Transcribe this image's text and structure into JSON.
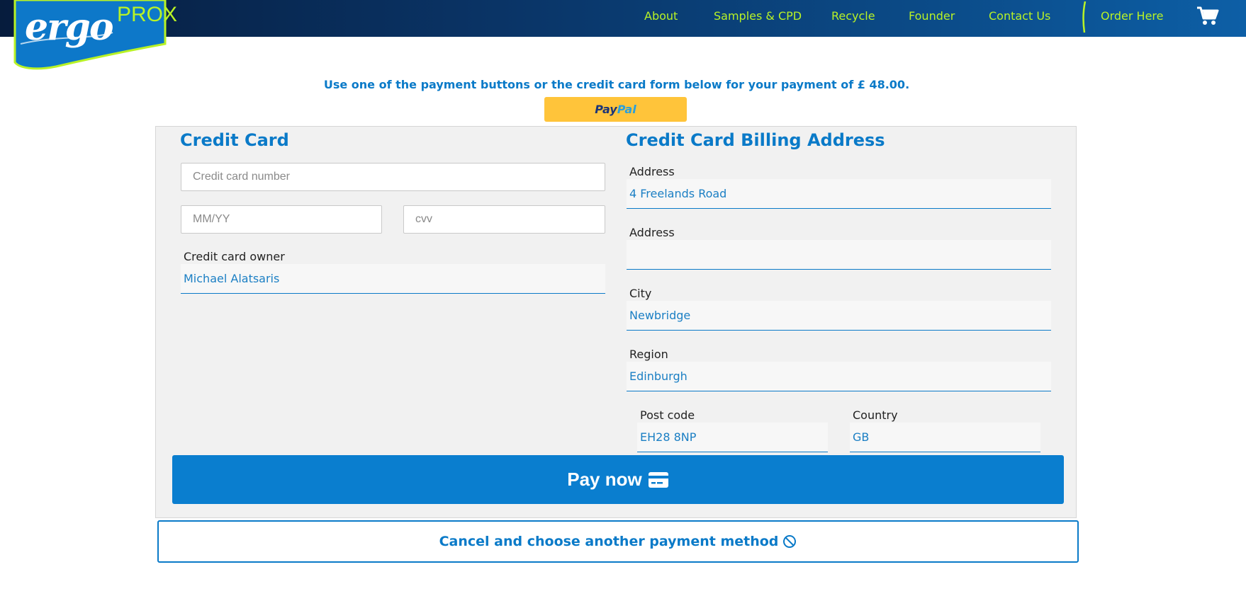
{
  "brand": {
    "logo_main": "ergo",
    "logo_sub": "PROX"
  },
  "nav": {
    "items": [
      {
        "label": "About"
      },
      {
        "label": "Samples & CPD"
      },
      {
        "label": "Recycle"
      },
      {
        "label": "Founder"
      },
      {
        "label": "Contact Us"
      },
      {
        "label": "Order Here"
      }
    ]
  },
  "payment": {
    "intro": "Use one of the payment buttons or the credit card form below for your payment of £ 48.00.",
    "paypal_part1": "Pay",
    "paypal_part2": "Pal"
  },
  "credit_card": {
    "title": "Credit Card",
    "number_placeholder": "Credit card number",
    "expiry_placeholder": "MM/YY",
    "cvv_placeholder": "cvv",
    "owner_label": "Credit card owner",
    "owner_value": "Michael Alatsaris"
  },
  "billing": {
    "title": "Credit Card Billing Address",
    "address1_label": "Address",
    "address1_value": "4 Freelands Road",
    "address2_label": "Address",
    "address2_value": "",
    "city_label": "City",
    "city_value": "Newbridge",
    "region_label": "Region",
    "region_value": "Edinburgh",
    "postcode_label": "Post code",
    "postcode_value": "EH28 8NP",
    "country_label": "Country",
    "country_value": "GB"
  },
  "actions": {
    "pay_label": "Pay now",
    "cancel_label": "Cancel and choose another payment method"
  },
  "colors": {
    "accent": "#0a7ac8",
    "nav_text": "#b8f226",
    "paypal_yellow": "#ffc43a",
    "pay_button": "#0a7ecf"
  },
  "icons": {
    "cart": "cart-icon",
    "pay": "credit-card-icon",
    "cancel": "ban-icon"
  }
}
